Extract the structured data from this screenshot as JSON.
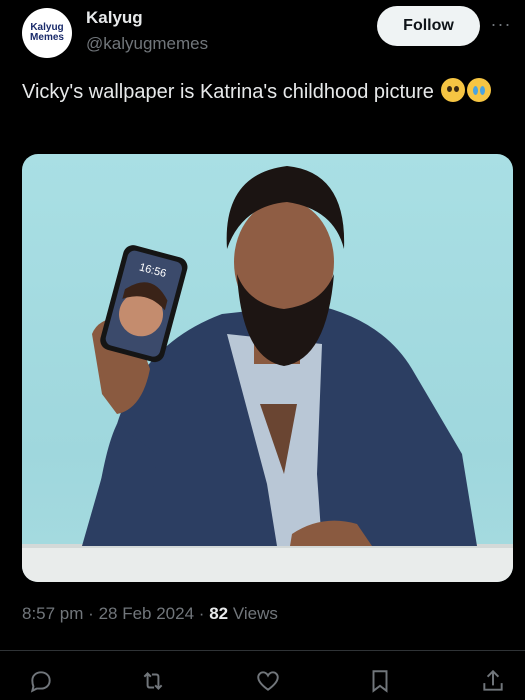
{
  "author": {
    "avatar_line1": "Kalyug",
    "avatar_line2": "Memes",
    "name": "Kalyug",
    "handle": "@kalyugmemes"
  },
  "follow_label": "Follow",
  "more_icon": "more-horizontal-icon",
  "tweet": {
    "text": "Vicky's wallpaper is Katrina's childhood picture",
    "emojis": [
      "pleading-face",
      "loudly-crying-face"
    ]
  },
  "photo": {
    "phone_time": "16:56"
  },
  "meta": {
    "time": "8:57 pm",
    "separator1": "·",
    "date": "28 Feb 2024",
    "separator2": "·",
    "views_count": "82",
    "views_label": "Views"
  },
  "actions": [
    "reply-icon",
    "retweet-icon",
    "like-icon",
    "bookmark-icon",
    "share-icon"
  ],
  "colors": {
    "background": "#000000",
    "text_primary": "#e7e9ea",
    "text_secondary": "#71767b",
    "follow_bg": "#eff3f4",
    "divider": "#2f3336"
  }
}
